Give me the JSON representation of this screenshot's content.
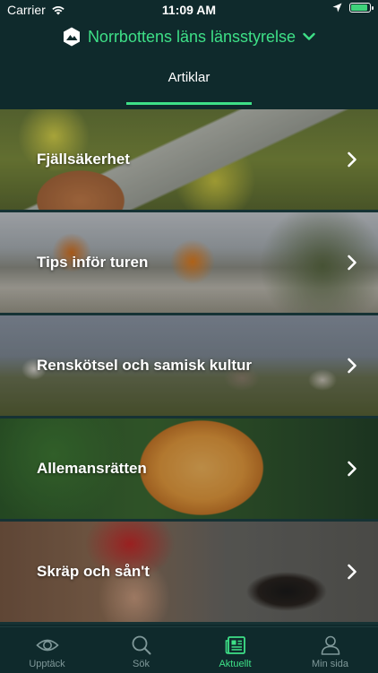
{
  "status": {
    "carrier": "Carrier",
    "time": "11:09 AM"
  },
  "header": {
    "org_title": "Norrbottens läns länsstyrelse",
    "tab_label": "Artiklar"
  },
  "articles": [
    {
      "title": "Fjällsäkerhet"
    },
    {
      "title": "Tips inför turen"
    },
    {
      "title": "Renskötsel och samisk kultur"
    },
    {
      "title": "Allemansrätten"
    },
    {
      "title": "Skräp och sån't"
    }
  ],
  "tabbar": {
    "items": [
      {
        "label": "Upptäck",
        "icon": "eye-icon"
      },
      {
        "label": "Sök",
        "icon": "search-icon"
      },
      {
        "label": "Aktuellt",
        "icon": "newspaper-icon"
      },
      {
        "label": "Min sida",
        "icon": "person-icon"
      }
    ],
    "active_index": 2
  },
  "colors": {
    "accent": "#3ee087",
    "background": "#0f2a2c",
    "inactive": "#7f9899"
  }
}
